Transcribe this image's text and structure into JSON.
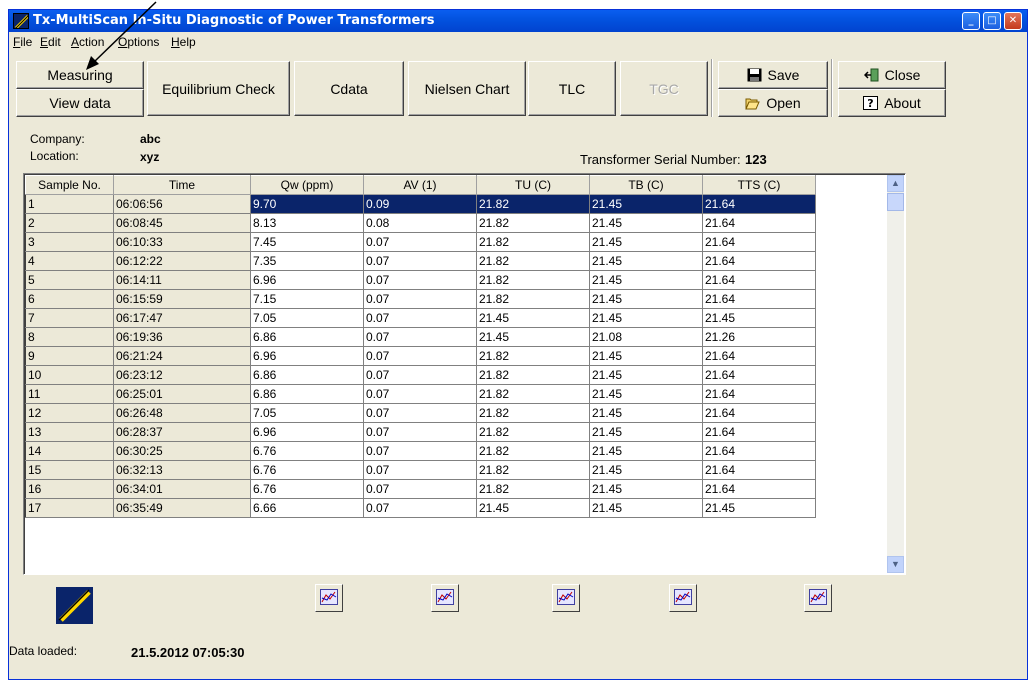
{
  "window": {
    "title": "Tx-MultiScan In-Situ Diagnostic of Power Transformers",
    "min_label": "_",
    "max_label": "□",
    "close_label": "✕"
  },
  "menu": [
    {
      "first": "F",
      "rest": "ile"
    },
    {
      "first": "E",
      "rest": "dit"
    },
    {
      "first": "A",
      "rest": "ction"
    },
    {
      "first": "O",
      "rest": "ptions"
    },
    {
      "first": "H",
      "rest": "elp"
    }
  ],
  "toolbar": {
    "measuring": "Measuring",
    "view_data": "View data",
    "equilibrium": "Equilibrium Check",
    "cdata": "Cdata",
    "nielsen": "Nielsen Chart",
    "tlc": "TLC",
    "tgc": "TGC",
    "save": "Save",
    "open": "Open",
    "close": "Close",
    "about": "About"
  },
  "info": {
    "company_label": "Company:",
    "company": "abc",
    "location_label": "Location:",
    "location": "xyz",
    "serial_label": "Transformer Serial Number:",
    "serial": "123"
  },
  "grid": {
    "headers": [
      "Sample No.",
      "Time",
      "Qw (ppm)",
      "AV (1)",
      "TU (C)",
      "TB (C)",
      "TTS (C)"
    ],
    "rows": [
      [
        "1",
        "06:06:56",
        "9.70",
        "0.09",
        "21.82",
        "21.45",
        "21.64"
      ],
      [
        "2",
        "06:08:45",
        "8.13",
        "0.08",
        "21.82",
        "21.45",
        "21.64"
      ],
      [
        "3",
        "06:10:33",
        "7.45",
        "0.07",
        "21.82",
        "21.45",
        "21.64"
      ],
      [
        "4",
        "06:12:22",
        "7.35",
        "0.07",
        "21.82",
        "21.45",
        "21.64"
      ],
      [
        "5",
        "06:14:11",
        "6.96",
        "0.07",
        "21.82",
        "21.45",
        "21.64"
      ],
      [
        "6",
        "06:15:59",
        "7.15",
        "0.07",
        "21.82",
        "21.45",
        "21.64"
      ],
      [
        "7",
        "06:17:47",
        "7.05",
        "0.07",
        "21.45",
        "21.45",
        "21.45"
      ],
      [
        "8",
        "06:19:36",
        "6.86",
        "0.07",
        "21.45",
        "21.08",
        "21.26"
      ],
      [
        "9",
        "06:21:24",
        "6.96",
        "0.07",
        "21.82",
        "21.45",
        "21.64"
      ],
      [
        "10",
        "06:23:12",
        "6.86",
        "0.07",
        "21.82",
        "21.45",
        "21.64"
      ],
      [
        "11",
        "06:25:01",
        "6.86",
        "0.07",
        "21.82",
        "21.45",
        "21.64"
      ],
      [
        "12",
        "06:26:48",
        "7.05",
        "0.07",
        "21.82",
        "21.45",
        "21.64"
      ],
      [
        "13",
        "06:28:37",
        "6.96",
        "0.07",
        "21.82",
        "21.45",
        "21.64"
      ],
      [
        "14",
        "06:30:25",
        "6.76",
        "0.07",
        "21.82",
        "21.45",
        "21.64"
      ],
      [
        "15",
        "06:32:13",
        "6.76",
        "0.07",
        "21.82",
        "21.45",
        "21.64"
      ],
      [
        "16",
        "06:34:01",
        "6.76",
        "0.07",
        "21.82",
        "21.45",
        "21.64"
      ],
      [
        "17",
        "06:35:49",
        "6.66",
        "0.07",
        "21.45",
        "21.45",
        "21.45"
      ]
    ],
    "selected_row": 1,
    "scroll_up": "▲",
    "scroll_down": "▼"
  },
  "footer": {
    "data_loaded_label": "Data loaded:",
    "data_loaded": "21.5.2012 07:05:30"
  },
  "icons": {
    "app": "transformer-logo-icon",
    "chart": "chart-icon",
    "save": "floppy-disk-icon",
    "open": "folder-open-icon",
    "close": "exit-icon",
    "about": "help-icon"
  },
  "colors": {
    "title_bar": "#0353e0",
    "selection": "#0a246a",
    "face": "#ece9d8"
  }
}
